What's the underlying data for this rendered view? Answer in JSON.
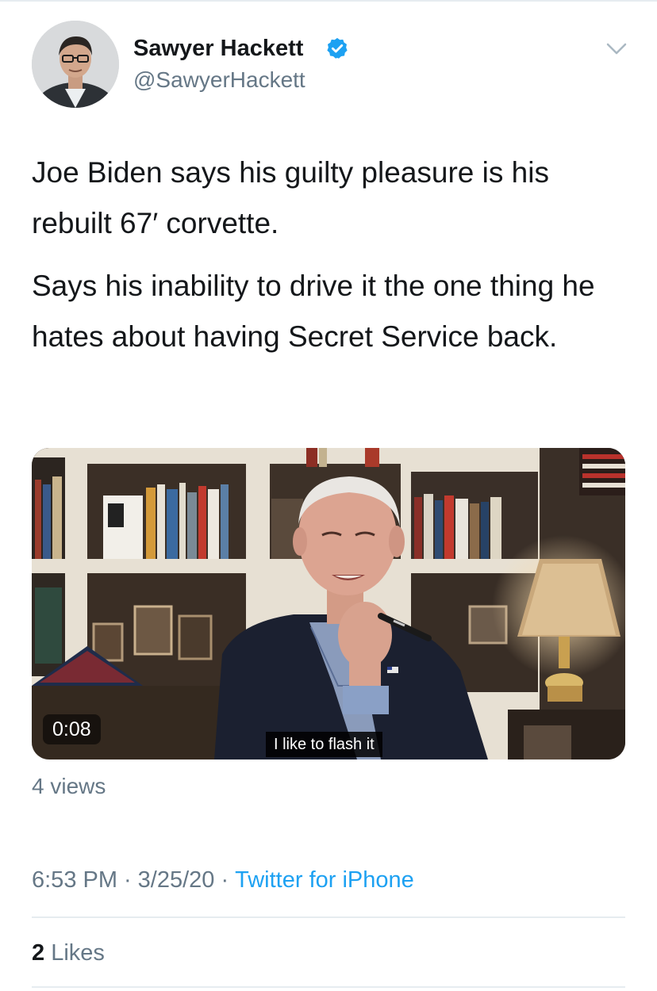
{
  "author": {
    "name": "Sawyer Hackett",
    "handle": "@SawyerHackett",
    "verified": true
  },
  "tweet": {
    "paragraphs": [
      "Joe Biden says his guilty pleasure is his rebuilt 67′ corvette.",
      "Says his inability to drive it the one thing he hates about having Secret Service back."
    ]
  },
  "media": {
    "type": "video",
    "duration": "0:08",
    "caption": "I like to flash it",
    "views": "4 views"
  },
  "meta": {
    "time": "6:53 PM",
    "separator": "·",
    "date": "3/25/20",
    "source": "Twitter for iPhone"
  },
  "stats": {
    "likes_count": "2",
    "likes_label": "Likes"
  },
  "icons": {
    "verified": "verified-badge-icon",
    "menu": "chevron-down-icon"
  },
  "colors": {
    "text": "#14171a",
    "secondary": "#657786",
    "link": "#1da1f2",
    "divider": "#e6ecf0"
  }
}
